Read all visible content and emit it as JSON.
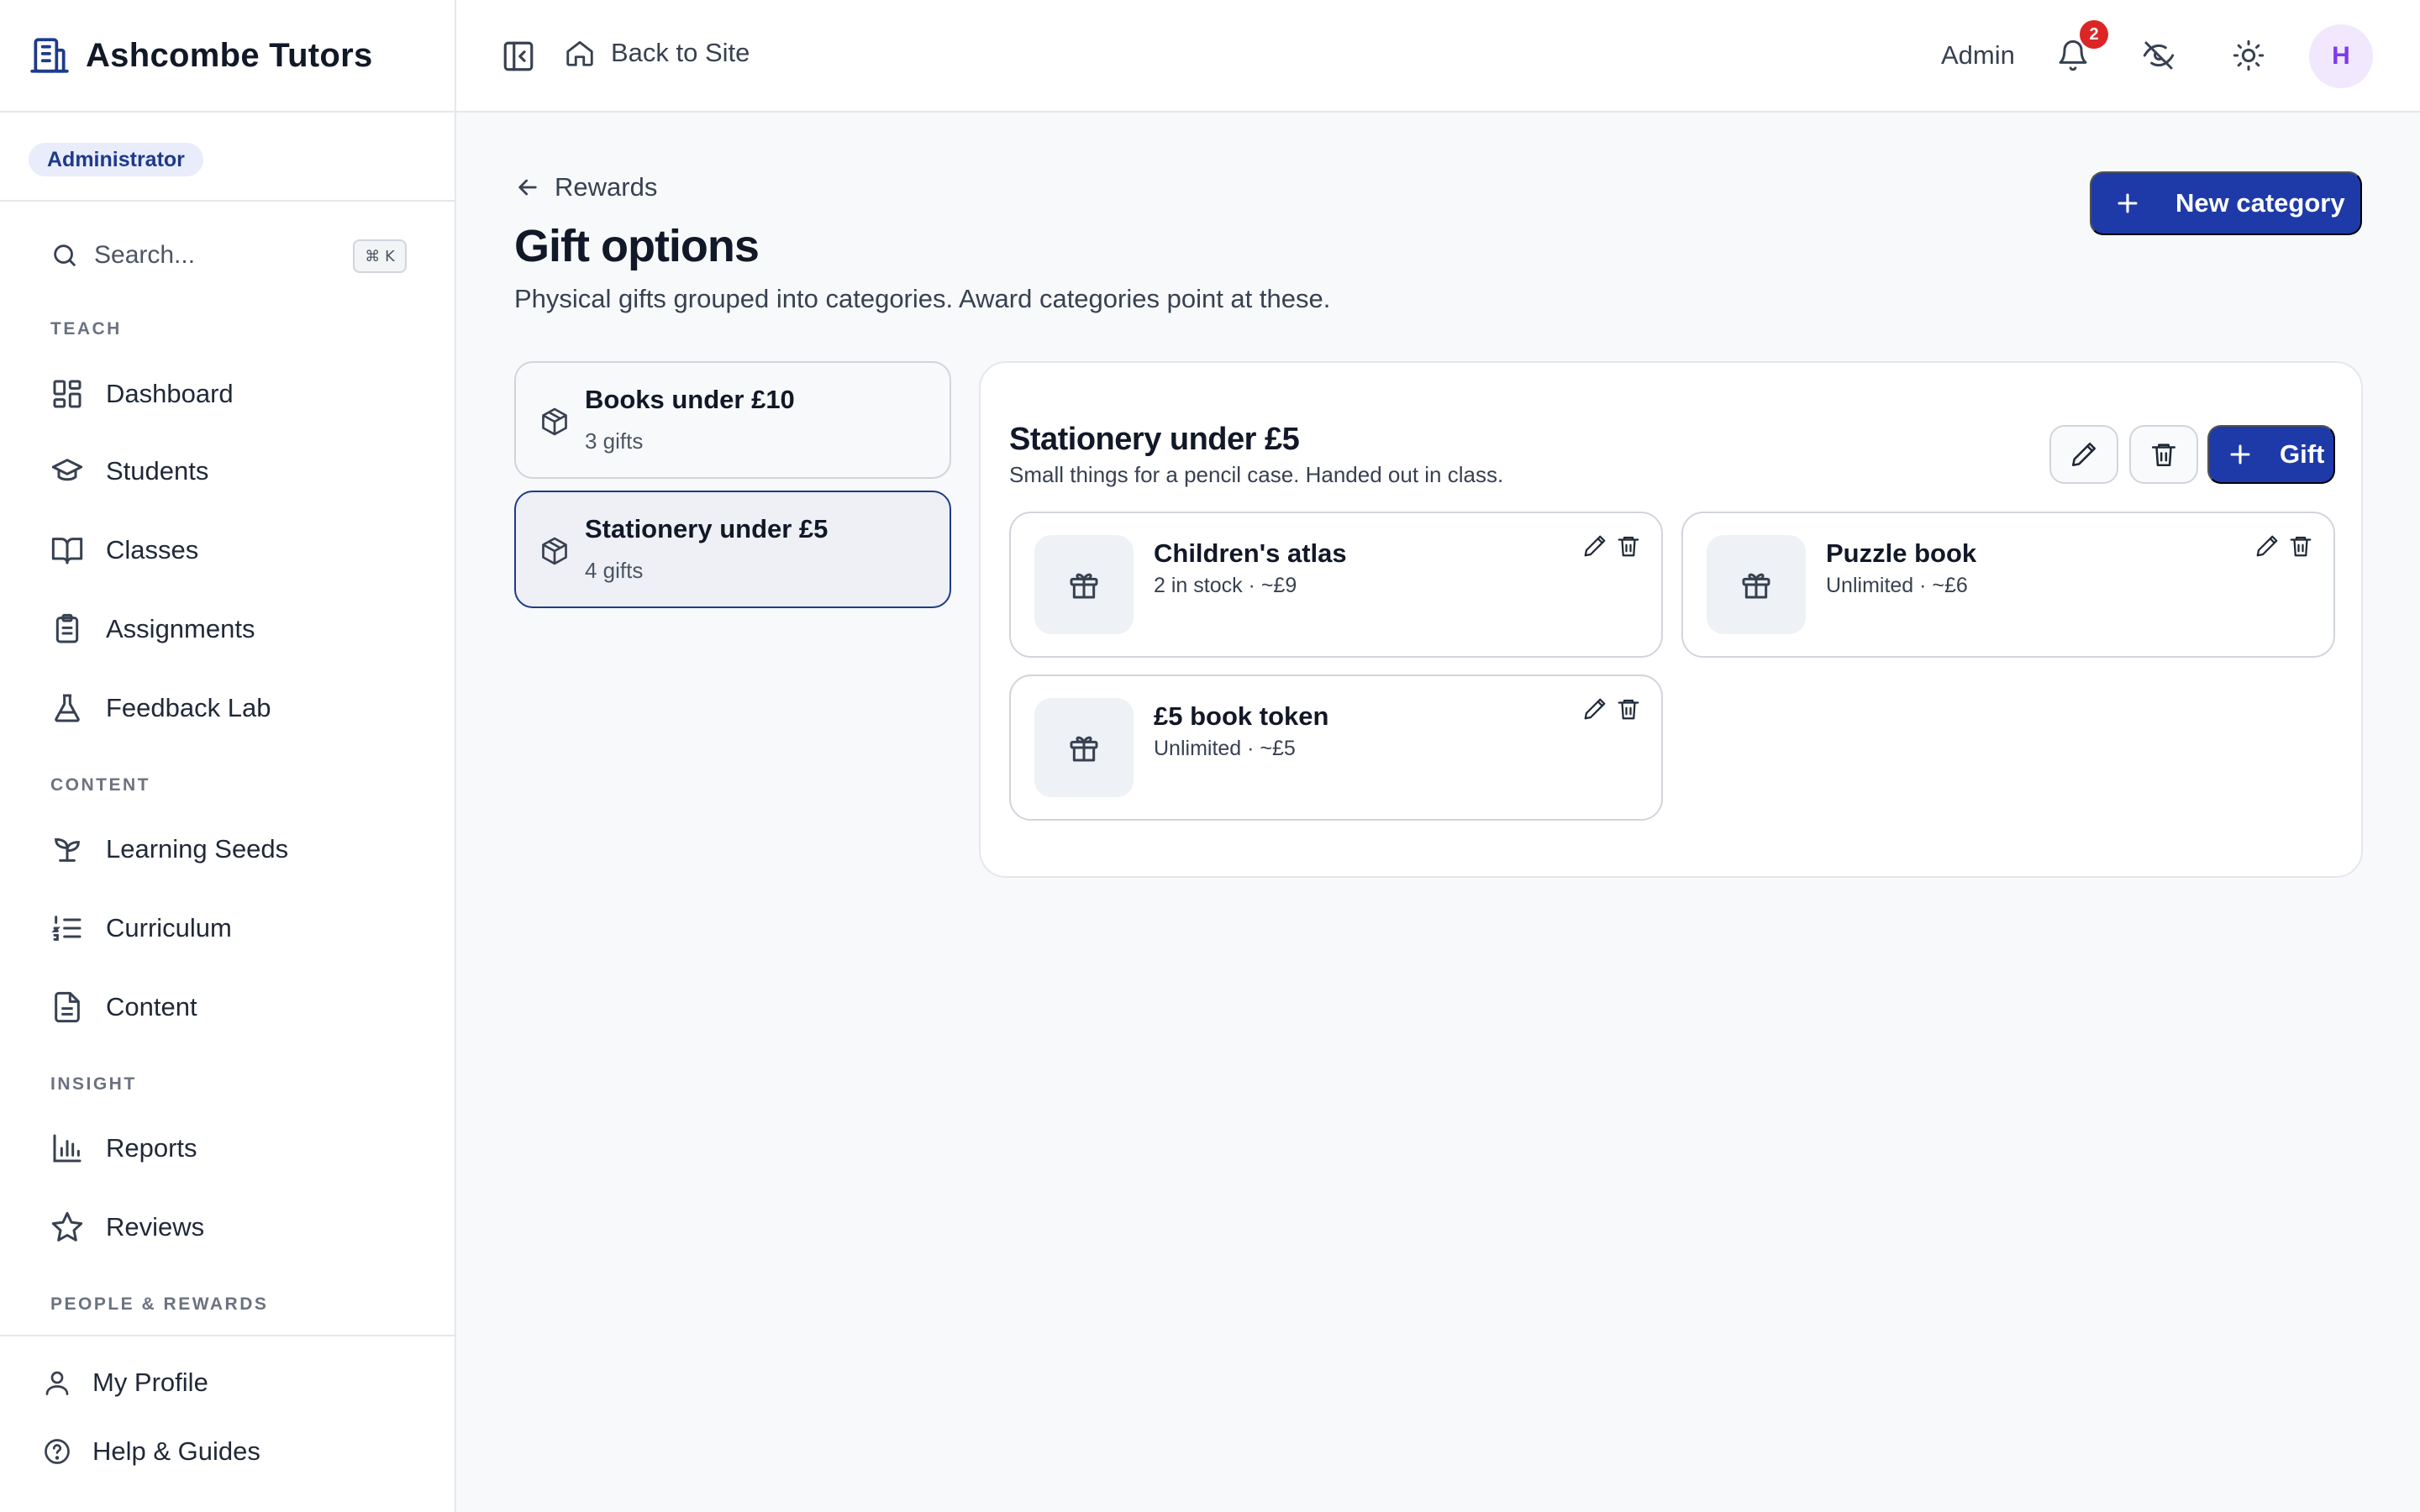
{
  "app": {
    "name": "Ashcombe Tutors",
    "role_badge": "Administrator"
  },
  "sidebar": {
    "search_placeholder": "Search...",
    "search_shortcut": "⌘ K",
    "sections": [
      {
        "label": "TEACH",
        "items": [
          {
            "label": "Dashboard",
            "icon": "dashboard-icon"
          },
          {
            "label": "Students",
            "icon": "graduation-cap-icon"
          },
          {
            "label": "Classes",
            "icon": "book-open-icon"
          },
          {
            "label": "Assignments",
            "icon": "clipboard-icon"
          },
          {
            "label": "Feedback Lab",
            "icon": "flask-icon"
          }
        ]
      },
      {
        "label": "CONTENT",
        "items": [
          {
            "label": "Learning Seeds",
            "icon": "sprout-icon"
          },
          {
            "label": "Curriculum",
            "icon": "list-ordered-icon"
          },
          {
            "label": "Content",
            "icon": "file-text-icon"
          }
        ]
      },
      {
        "label": "INSIGHT",
        "items": [
          {
            "label": "Reports",
            "icon": "bar-chart-icon"
          },
          {
            "label": "Reviews",
            "icon": "star-icon"
          }
        ]
      },
      {
        "label": "PEOPLE & REWARDS",
        "items": []
      }
    ],
    "bottom": [
      {
        "label": "My Profile",
        "icon": "user-icon"
      },
      {
        "label": "Help & Guides",
        "icon": "help-circle-icon"
      }
    ]
  },
  "topbar": {
    "back_to_site": "Back to Site",
    "user_label": "Admin",
    "notification_count": "2",
    "avatar_initial": "H"
  },
  "page": {
    "breadcrumb": "Rewards",
    "title": "Gift options",
    "subtitle": "Physical gifts grouped into categories. Award categories point at these.",
    "new_category_label": "New category"
  },
  "categories": [
    {
      "name": "Books under £10",
      "count": "3 gifts",
      "selected": false
    },
    {
      "name": "Stationery under £5",
      "count": "4 gifts",
      "selected": true
    }
  ],
  "selected_category": {
    "name": "Stationery under £5",
    "description": "Small things for a pencil case. Handed out in class.",
    "add_gift_label": "Gift",
    "gifts": [
      {
        "name": "Children's atlas",
        "meta": "2 in stock · ~£9"
      },
      {
        "name": "Puzzle book",
        "meta": "Unlimited · ~£6"
      },
      {
        "name": "£5 book token",
        "meta": "Unlimited · ~£5"
      }
    ]
  },
  "colors": {
    "primary": "#1e3aa8",
    "badge_bg": "#e8ecfb",
    "notification": "#dc2626",
    "avatar_bg": "#f1e8fd",
    "avatar_text": "#7c3aed"
  }
}
